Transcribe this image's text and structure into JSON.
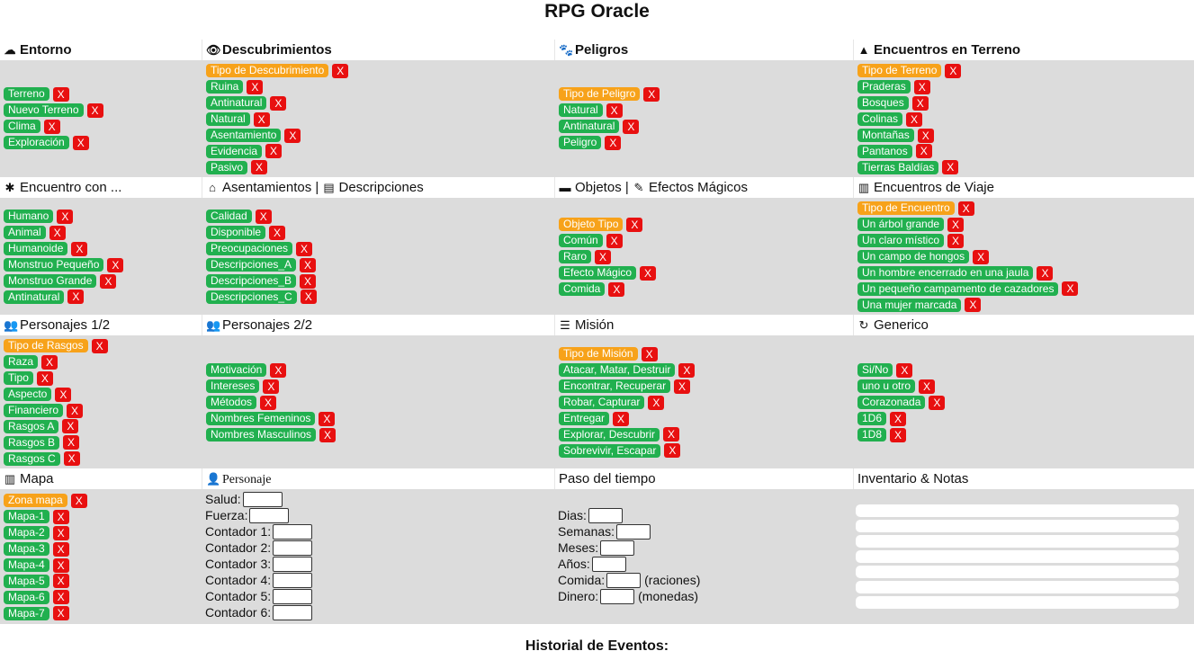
{
  "title": "RPG Oracle",
  "row1": {
    "col1": {
      "header": "Entorno",
      "items": [
        {
          "label": "Terreno",
          "type": "g"
        },
        {
          "label": "Nuevo Terreno",
          "type": "g"
        },
        {
          "label": "Clima",
          "type": "g"
        },
        {
          "label": "Exploración",
          "type": "g"
        }
      ]
    },
    "col2": {
      "header": "Descubrimientos",
      "items": [
        {
          "label": "Tipo de Descubrimiento",
          "type": "o"
        },
        {
          "label": "Ruina",
          "type": "g"
        },
        {
          "label": "Antinatural",
          "type": "g"
        },
        {
          "label": "Natural",
          "type": "g"
        },
        {
          "label": "Asentamiento",
          "type": "g"
        },
        {
          "label": "Evidencia",
          "type": "g"
        },
        {
          "label": "Pasivo",
          "type": "g"
        }
      ]
    },
    "col3": {
      "header": "Peligros",
      "items": [
        {
          "label": "Tipo de Peligro",
          "type": "o"
        },
        {
          "label": "Natural",
          "type": "g"
        },
        {
          "label": "Antinatural",
          "type": "g"
        },
        {
          "label": "Peligro",
          "type": "g"
        }
      ]
    },
    "col4": {
      "header": "Encuentros en Terreno",
      "items": [
        {
          "label": "Tipo de Terreno",
          "type": "o"
        },
        {
          "label": "Praderas",
          "type": "g"
        },
        {
          "label": "Bosques",
          "type": "g"
        },
        {
          "label": "Colinas",
          "type": "g"
        },
        {
          "label": "Montañas",
          "type": "g"
        },
        {
          "label": "Pantanos",
          "type": "g"
        },
        {
          "label": "Tierras Baldías",
          "type": "g"
        }
      ]
    }
  },
  "row2": {
    "col1": {
      "header": "Encuentro con ...",
      "items": [
        {
          "label": "Humano",
          "type": "g"
        },
        {
          "label": "Animal",
          "type": "g"
        },
        {
          "label": "Humanoide",
          "type": "g"
        },
        {
          "label": "Monstruo Pequeño",
          "type": "g"
        },
        {
          "label": "Monstruo Grande",
          "type": "g"
        },
        {
          "label": "Antinatural",
          "type": "g"
        }
      ]
    },
    "col2": {
      "header_a": "Asentamientos",
      "header_sep": "|",
      "header_b": "Descripciones",
      "items": [
        {
          "label": "Calidad",
          "type": "g"
        },
        {
          "label": "Disponible",
          "type": "g"
        },
        {
          "label": "Preocupaciones",
          "type": "g"
        },
        {
          "label": "Descripciones_A",
          "type": "g"
        },
        {
          "label": "Descripciones_B",
          "type": "g"
        },
        {
          "label": "Descripciones_C",
          "type": "g"
        }
      ]
    },
    "col3": {
      "header_a": "Objetos",
      "header_sep": "|",
      "header_b": "Efectos Mágicos",
      "items": [
        {
          "label": "Objeto Tipo",
          "type": "o"
        },
        {
          "label": "Común",
          "type": "g"
        },
        {
          "label": "Raro",
          "type": "g"
        },
        {
          "label": "Efecto Mágico",
          "type": "g"
        },
        {
          "label": "Comida",
          "type": "g"
        }
      ]
    },
    "col4": {
      "header": "Encuentros de Viaje",
      "items": [
        {
          "label": "Tipo de Encuentro",
          "type": "o"
        },
        {
          "label": "Un árbol grande",
          "type": "g"
        },
        {
          "label": "Un claro místico",
          "type": "g"
        },
        {
          "label": "Un campo de hongos",
          "type": "g"
        },
        {
          "label": "Un hombre encerrado en una jaula",
          "type": "g"
        },
        {
          "label": "Un pequeño campamento de cazadores",
          "type": "g"
        },
        {
          "label": "Una mujer marcada",
          "type": "g"
        }
      ]
    }
  },
  "row3": {
    "col1": {
      "header": "Personajes 1/2",
      "items": [
        {
          "label": "Tipo de Rasgos",
          "type": "o"
        },
        {
          "label": "Raza",
          "type": "g"
        },
        {
          "label": "Tipo",
          "type": "g"
        },
        {
          "label": "Aspecto",
          "type": "g"
        },
        {
          "label": "Financiero",
          "type": "g"
        },
        {
          "label": "Rasgos A",
          "type": "g"
        },
        {
          "label": "Rasgos B",
          "type": "g"
        },
        {
          "label": "Rasgos C",
          "type": "g"
        }
      ]
    },
    "col2": {
      "header": "Personajes 2/2",
      "items": [
        {
          "label": "Motivación",
          "type": "g"
        },
        {
          "label": "Intereses",
          "type": "g"
        },
        {
          "label": "Métodos",
          "type": "g"
        },
        {
          "label": "Nombres Femeninos",
          "type": "g"
        },
        {
          "label": "Nombres Masculinos",
          "type": "g"
        }
      ]
    },
    "col3": {
      "header": "Misión",
      "items": [
        {
          "label": "Tipo de Misión",
          "type": "o"
        },
        {
          "label": "Atacar, Matar, Destruir",
          "type": "g"
        },
        {
          "label": "Encontrar, Recuperar",
          "type": "g"
        },
        {
          "label": "Robar, Capturar",
          "type": "g"
        },
        {
          "label": "Entregar",
          "type": "g"
        },
        {
          "label": "Explorar, Descubrir",
          "type": "g"
        },
        {
          "label": "Sobrevivir, Escapar",
          "type": "g"
        }
      ]
    },
    "col4": {
      "header": "Generico",
      "items": [
        {
          "label": "Si/No",
          "type": "g"
        },
        {
          "label": "uno u otro",
          "type": "g"
        },
        {
          "label": "Corazonada",
          "type": "g"
        },
        {
          "label": "1D6",
          "type": "g"
        },
        {
          "label": "1D8",
          "type": "g"
        }
      ]
    }
  },
  "row4": {
    "col1": {
      "header": "Mapa",
      "items": [
        {
          "label": "Zona mapa",
          "type": "o"
        },
        {
          "label": "Mapa-1",
          "type": "g"
        },
        {
          "label": "Mapa-2",
          "type": "g"
        },
        {
          "label": "Mapa-3",
          "type": "g"
        },
        {
          "label": "Mapa-4",
          "type": "g"
        },
        {
          "label": "Mapa-5",
          "type": "g"
        },
        {
          "label": "Mapa-6",
          "type": "g"
        },
        {
          "label": "Mapa-7",
          "type": "g"
        }
      ]
    },
    "col2": {
      "header": "Personaje",
      "fields": [
        "Salud:",
        "Fuerza:",
        "Contador 1:",
        "Contador 2:",
        "Contador 3:",
        "Contador 4:",
        "Contador 5:",
        "Contador 6:"
      ]
    },
    "col3": {
      "header": "Paso del tiempo",
      "fields": [
        {
          "label": "Dias:",
          "suffix": ""
        },
        {
          "label": "Semanas:",
          "suffix": ""
        },
        {
          "label": "Meses:",
          "suffix": ""
        },
        {
          "label": "Años:",
          "suffix": ""
        },
        {
          "label": "Comida:",
          "suffix": "(raciones)"
        },
        {
          "label": "Dinero:",
          "suffix": "(monedas)"
        }
      ]
    },
    "col4": {
      "header": "Inventario & Notas"
    }
  },
  "remove_label": "X",
  "footer": "Historial de Eventos:",
  "colors": {
    "green": "#21b04f",
    "orange": "#f7a21a",
    "red": "#e81010",
    "panel": "#dcdcdc"
  }
}
